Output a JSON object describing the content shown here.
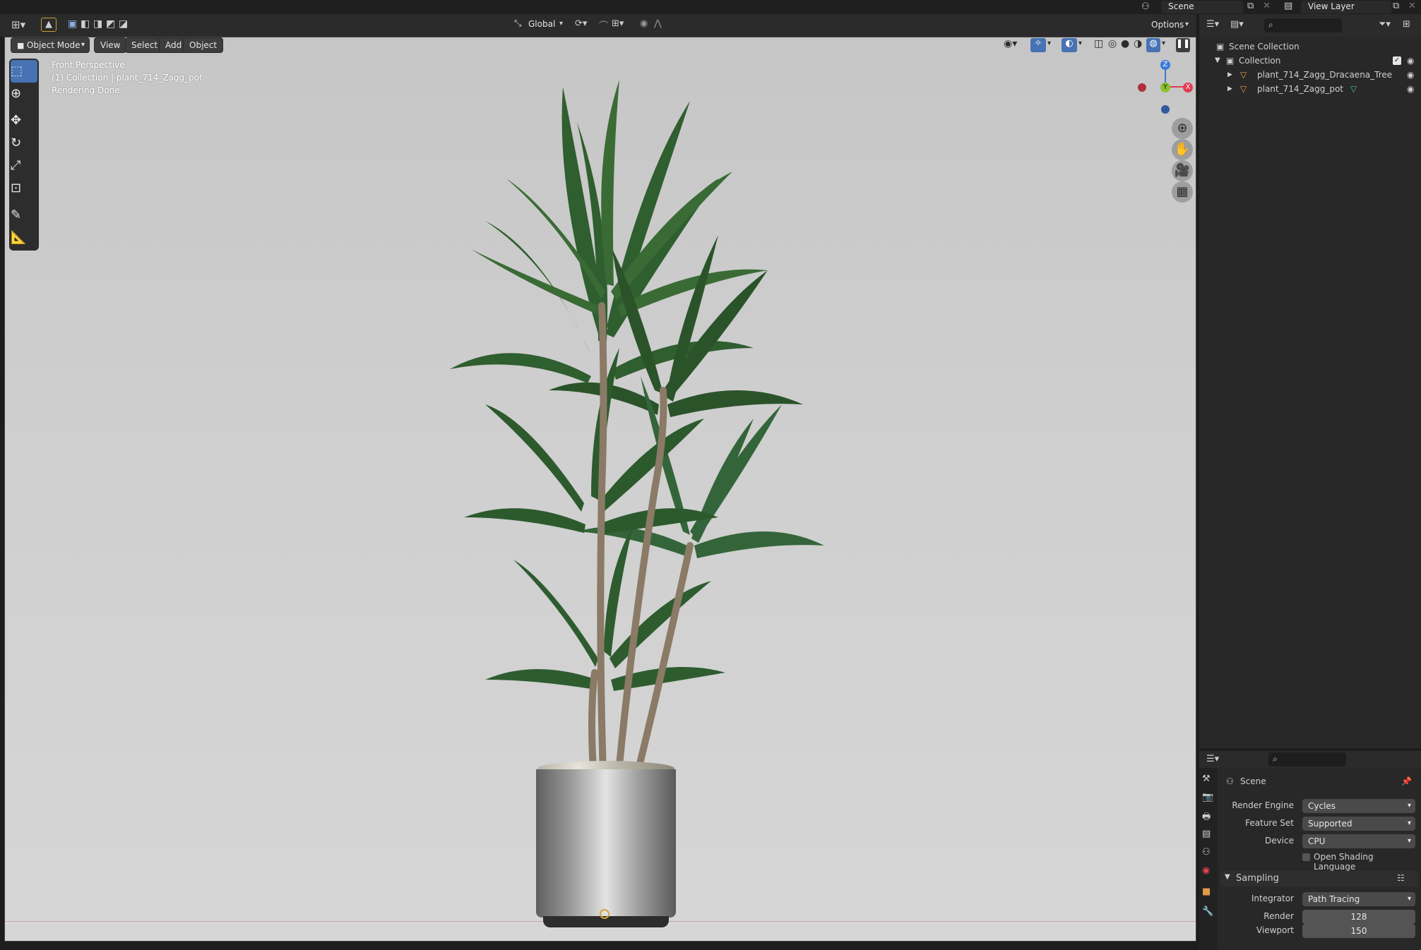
{
  "top_bar": {
    "scene_label": "Scene",
    "view_layer_label": "View Layer"
  },
  "viewport_header": {
    "transform_orientation": "Global",
    "options_label": "Options",
    "mode": "Object Mode",
    "menus": [
      "View",
      "Select",
      "Add",
      "Object"
    ]
  },
  "viewport_overlay": {
    "view_name": "Front Perspective",
    "collection_info": "(1) Collection | plant_714_Zagg_pot",
    "status": "Rendering Done"
  },
  "gizmo": {
    "z_label": "Z",
    "y_label": "Y",
    "x_label": "X",
    "colors": {
      "x": "#e33b4f",
      "y": "#8ac22f",
      "z": "#3b7ad6",
      "neg_x": "#b03040",
      "neg_z": "#2f5aa0"
    }
  },
  "outliner": {
    "root": "Scene Collection",
    "collection": "Collection",
    "items": [
      {
        "name": "plant_714_Zagg_Dracaena_Tree"
      },
      {
        "name": "plant_714_Zagg_pot"
      }
    ]
  },
  "properties": {
    "context": "Scene",
    "render_engine_label": "Render Engine",
    "render_engine": "Cycles",
    "feature_set_label": "Feature Set",
    "feature_set": "Supported",
    "device_label": "Device",
    "device": "CPU",
    "osl_label": "Open Shading Language",
    "sampling_panel": "Sampling",
    "integrator_label": "Integrator",
    "integrator": "Path Tracing",
    "render_label": "Render",
    "render_samples": "128",
    "viewport_label": "Viewport",
    "viewport_samples": "150"
  },
  "colors": {
    "accent": "#4772b3",
    "ui_bg": "#2b2b2b",
    "viewport_bg": "#cccccc"
  }
}
